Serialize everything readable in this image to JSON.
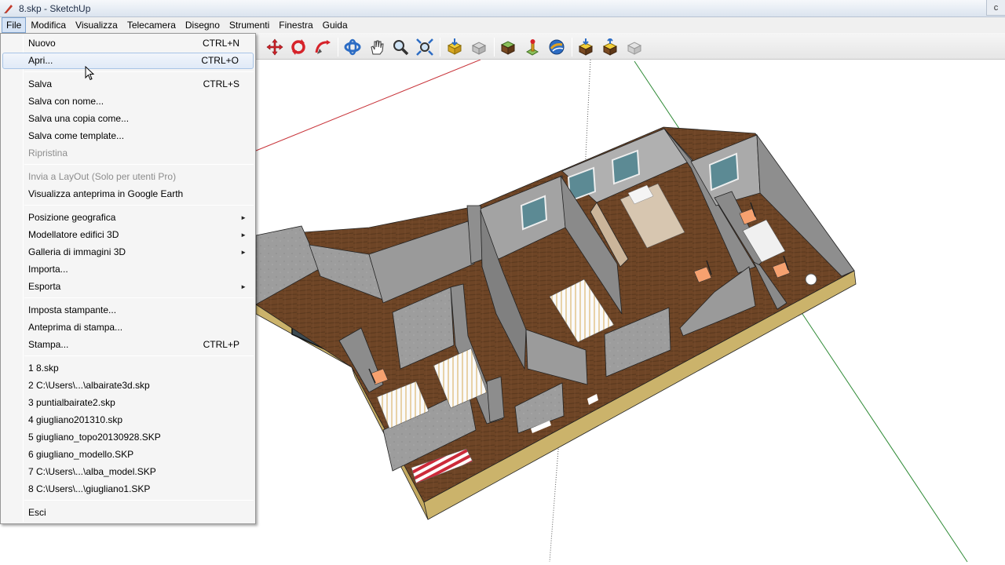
{
  "window": {
    "title": "8.skp - SketchUp",
    "close_label": "c"
  },
  "menubar": {
    "items": [
      "File",
      "Modifica",
      "Visualizza",
      "Telecamera",
      "Disegno",
      "Strumenti",
      "Finestra",
      "Guida"
    ]
  },
  "file_menu": {
    "nuovo": {
      "label": "Nuovo",
      "shortcut": "CTRL+N"
    },
    "apri": {
      "label": "Apri...",
      "shortcut": "CTRL+O"
    },
    "salva": {
      "label": "Salva",
      "shortcut": "CTRL+S"
    },
    "salva_con_nome": {
      "label": "Salva con nome..."
    },
    "salva_copia": {
      "label": "Salva una copia come..."
    },
    "salva_template": {
      "label": "Salva come template..."
    },
    "ripristina": {
      "label": "Ripristina"
    },
    "invia_layout": {
      "label": "Invia a LayOut (Solo per utenti Pro)"
    },
    "google_earth": {
      "label": "Visualizza anteprima in Google Earth"
    },
    "posizione": {
      "label": "Posizione geografica"
    },
    "modellatore": {
      "label": "Modellatore edifici 3D"
    },
    "galleria": {
      "label": "Galleria di immagini 3D"
    },
    "importa": {
      "label": "Importa..."
    },
    "esporta": {
      "label": "Esporta"
    },
    "imposta_stampante": {
      "label": "Imposta stampante..."
    },
    "anteprima_stampa": {
      "label": "Anteprima di stampa..."
    },
    "stampa": {
      "label": "Stampa...",
      "shortcut": "CTRL+P"
    },
    "recent": [
      "1 8.skp",
      "2 C:\\Users\\...\\albairate3d.skp",
      "3 puntialbairate2.skp",
      "4 giugliano201310.skp",
      "5 giugliano_topo20130928.SKP",
      "6 giugliano_modello.SKP",
      "7 C:\\Users\\...\\alba_model.SKP",
      "8 C:\\Users\\...\\giugliano1.SKP"
    ],
    "esci": {
      "label": "Esci"
    },
    "submenu_arrow": "►"
  },
  "colors": {
    "floor": "#6e4526",
    "wall_face": "#9a9a9a",
    "wall_top": "#ffffff",
    "outer_wall": "#cbb36b",
    "menu_highlight": "#dce8f7"
  }
}
